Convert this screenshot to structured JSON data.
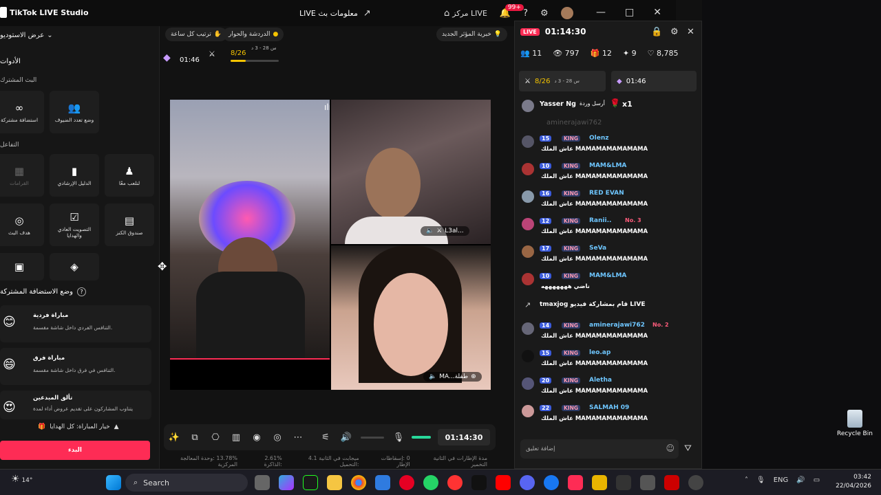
{
  "titlebar": {
    "app_name": "TikTok LIVE Studio",
    "live_info": "LIVE معلومات بث",
    "center_label": "مركز LIVE",
    "notif_count": "99+"
  },
  "sidebar": {
    "studio_view": "عرض الاستوديو",
    "tools_heading": "الأدوات",
    "shared_live_heading": "البث المشترك",
    "interaction_heading": "التفاعل",
    "tiles": [
      {
        "label": "استضافة مشتركة",
        "icon": "link-icon"
      },
      {
        "label": "وضع تعدد الضيوف",
        "icon": "people-icon"
      },
      {
        "label": "القرامات",
        "icon": "chart-icon"
      },
      {
        "label": "الدليل الإرشادي",
        "icon": "guide-icon"
      },
      {
        "label": "لنلعب معًا",
        "icon": "controller-icon"
      },
      {
        "label": "هدف البث",
        "icon": "target-icon"
      },
      {
        "label": "التصويت العادي والهدايا",
        "icon": "vote-icon"
      },
      {
        "label": "صندوق الكنز",
        "icon": "treasure-icon"
      }
    ],
    "cohost_mode_title": "وضع الاستضافة المشتركة",
    "games": [
      {
        "title": "مباراة فردية",
        "desc": "التنافس الفردي داخل شاشة مقسمة."
      },
      {
        "title": "مباراة فرق",
        "desc": "التنافس في فرق داخل شاشة مقسمة."
      },
      {
        "title": "تألق المبدعين",
        "desc": "يتناوب المشاركون على تقديم عروض أداء لمدة"
      }
    ],
    "gift_option": "خيار المباراة: كل الهدايا",
    "start_label": "البدء"
  },
  "stage": {
    "chip_hourly": "ترتيب كل ساعة",
    "chip_chat": "الدردشة والحوار",
    "chip_creator": "خبرية المؤثر الجديد",
    "mini_score": "8/26",
    "mini_progress": 0.31,
    "mini_rank_label": "س 28 - 3 د",
    "mini_timer": "01:46",
    "guest_b_name": "L3al...",
    "guest_c_name": "MA...طفلة"
  },
  "toolbar": {
    "timer": "01:14:30",
    "status": [
      "مدة الإطارات في الثانية التخمير",
      "0 :إسقاطات الإطار",
      "ميجابت في الثانية 4.1 :التحميل",
      "2.61% :الذاكرة",
      "13.78% :وحدة المعالجة المركزية"
    ]
  },
  "chat": {
    "live_label": "LIVE",
    "time": "01:14:30",
    "stats": {
      "viewers": "11",
      "views": "797",
      "gifts": "12",
      "members": "9",
      "likes": "8,785"
    },
    "hb_score": "8/26",
    "hb_timer": "01:46",
    "hb_rank": "س 28 - 3 د",
    "gift_sender": "Yasser Ng",
    "gift_text": "أرسل وردة",
    "gift_count": "x1",
    "messages": [
      {
        "level": "15",
        "badge": "KING",
        "name": "Olenz",
        "text": "عاش الملك MAMAMAMAMAMAMA",
        "tag": ""
      },
      {
        "level": "10",
        "badge": "KING",
        "name": "MAM&LMA",
        "text": "عاش الملك MAMAMAMAMAMAMA",
        "tag": ""
      },
      {
        "level": "16",
        "badge": "KING",
        "name": "RED EVAN",
        "text": "عاش الملك MAMAMAMAMAMAMA",
        "tag": ""
      },
      {
        "level": "12",
        "badge": "KING",
        "name": "Ranii..",
        "text": "عاش الملك MAMAMAMAMAMAMA",
        "tag": "No. 3"
      },
      {
        "level": "17",
        "badge": "KING",
        "name": "SeVa",
        "text": "عاش الملك MAMAMAMAMAMAMA",
        "tag": ""
      },
      {
        "level": "10",
        "badge": "KING",
        "name": "MAM&LMA",
        "text": "ناضي هههههههه",
        "tag": ""
      },
      {
        "level": "14",
        "badge": "KING",
        "name": "aminerajawi762",
        "text": "عاش الملك MAMAMAMAMAMAMA",
        "tag": "No. 2"
      },
      {
        "level": "15",
        "badge": "KING",
        "name": "leo.ap",
        "text": "عاش الملك MAMAMAMAMAMAMA",
        "tag": ""
      },
      {
        "level": "20",
        "badge": "KING",
        "name": "Aletha",
        "text": "عاش الملك MAMAMAMAMAMAMA",
        "tag": ""
      },
      {
        "level": "22",
        "badge": "KING",
        "name": "SALMAH 09",
        "text": "عاش الملك MAMAMAMAMAMAMA",
        "tag": ""
      }
    ],
    "share_note": "tmaxjog قام بمشاركة فيديو LIVE",
    "ghost_user": "aminerajawi762",
    "input_placeholder": "إضافة تعليق"
  },
  "desktop": {
    "recycle_bin": "Recycle Bin"
  },
  "taskbar": {
    "weather": "14°",
    "search": "Search",
    "lang": "ENG",
    "time": "03:42",
    "date": "22/04/2026"
  }
}
